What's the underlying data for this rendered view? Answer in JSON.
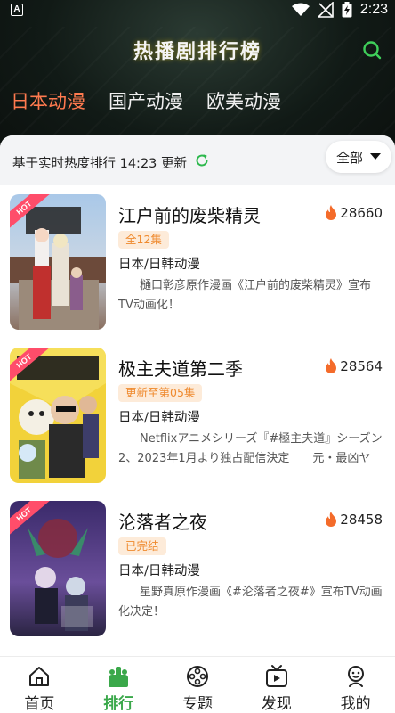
{
  "status_bar": {
    "time": "2:23"
  },
  "header": {
    "title": "热播剧排行榜",
    "tabs": [
      {
        "label": "日本动漫",
        "active": true
      },
      {
        "label": "国产动漫",
        "active": false
      },
      {
        "label": "欧美动漫",
        "active": false
      }
    ]
  },
  "subbar": {
    "text": "基于实时热度排行 14:23 更新",
    "filter_label": "全部"
  },
  "items": [
    {
      "title": "江户前的废柴精灵",
      "heat": "28660",
      "badge": "全12集",
      "region": "日本/日韩动漫",
      "description": "樋口彰彦原作漫画《江户前的废柴精灵》宣布TV动画化！",
      "hot": "HOT"
    },
    {
      "title": "极主夫道第二季",
      "heat": "28564",
      "badge": "更新至第05集",
      "region": "日本/日韩动漫",
      "description": "Netflixアニメシリーズ『#極主夫道』シーズン2、2023年1月より独占配信決定　　元・最凶ヤク…",
      "hot": "HOT"
    },
    {
      "title": "沦落者之夜",
      "heat": "28458",
      "badge": "已完结",
      "region": "日本/日韩动漫",
      "description": "星野真原作漫画《#沦落者之夜#》宣布TV动画化决定！",
      "hot": "HOT"
    }
  ],
  "bottom_nav": [
    {
      "label": "首页",
      "icon": "home-icon",
      "active": false
    },
    {
      "label": "排行",
      "icon": "ranking-icon",
      "active": true
    },
    {
      "label": "专题",
      "icon": "topic-icon",
      "active": false
    },
    {
      "label": "发现",
      "icon": "discover-icon",
      "active": false
    },
    {
      "label": "我的",
      "icon": "profile-icon",
      "active": false
    }
  ],
  "colors": {
    "accent_tab": "#ff7a4f",
    "accent_nav": "#3aa84a",
    "badge_bg": "#fdebd9",
    "badge_text": "#ef8a2e",
    "heat_icon": "#f46b2a"
  }
}
